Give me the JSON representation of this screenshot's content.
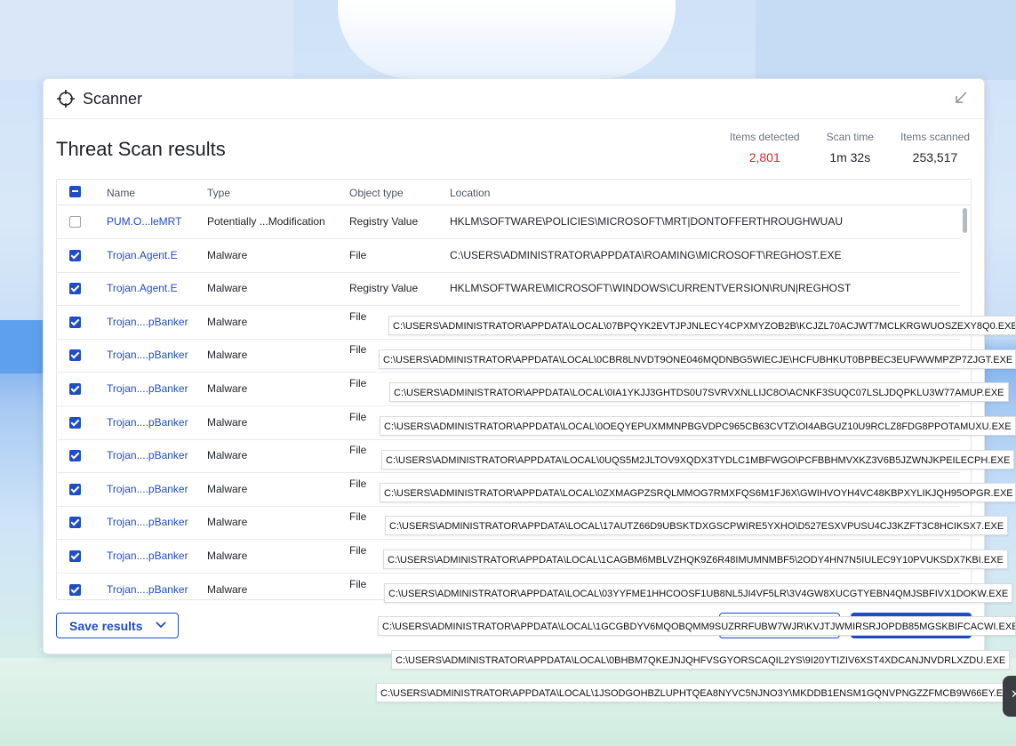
{
  "window": {
    "title": "Scanner",
    "page_title": "Threat Scan results"
  },
  "stats": [
    {
      "label": "Items detected",
      "value": "2,801",
      "color": "#d9262c"
    },
    {
      "label": "Scan time",
      "value": "1m 32s"
    },
    {
      "label": "Items scanned",
      "value": "253,517"
    }
  ],
  "table": {
    "headers": [
      "Name",
      "Type",
      "Object type",
      "Location"
    ],
    "rows": [
      {
        "checked": false,
        "name": "PUM.O...leMRT",
        "type": "Potentially ...Modification",
        "object": "Registry Value",
        "location": "HKLM\\SOFTWARE\\POLICIES\\MICROSOFT\\MRT|DONTOFFERTHROUGHWUAU"
      },
      {
        "checked": true,
        "name": "Trojan.Agent.E",
        "type": "Malware",
        "object": "File",
        "location": "C:\\USERS\\ADMINISTRATOR\\APPDATA\\ROAMING\\MICROSOFT\\REGHOST.EXE"
      },
      {
        "checked": true,
        "name": "Trojan.Agent.E",
        "type": "Malware",
        "object": "Registry Value",
        "location": "HKLM\\SOFTWARE\\MICROSOFT\\WINDOWS\\CURRENTVERSION\\RUN|REGHOST"
      },
      {
        "checked": true,
        "name": "Trojan....pBanker",
        "type": "Malware",
        "object": "File",
        "location": ""
      },
      {
        "checked": true,
        "name": "Trojan....pBanker",
        "type": "Malware",
        "object": "File",
        "location": ""
      },
      {
        "checked": true,
        "name": "Trojan....pBanker",
        "type": "Malware",
        "object": "File",
        "location": ""
      },
      {
        "checked": true,
        "name": "Trojan....pBanker",
        "type": "Malware",
        "object": "File",
        "location": ""
      },
      {
        "checked": true,
        "name": "Trojan....pBanker",
        "type": "Malware",
        "object": "File",
        "location": ""
      },
      {
        "checked": true,
        "name": "Trojan....pBanker",
        "type": "Malware",
        "object": "File",
        "location": ""
      },
      {
        "checked": true,
        "name": "Trojan....pBanker",
        "type": "Malware",
        "object": "File",
        "location": ""
      },
      {
        "checked": true,
        "name": "Trojan....pBanker",
        "type": "Malware",
        "object": "File",
        "location": ""
      },
      {
        "checked": true,
        "name": "Trojan....pBanker",
        "type": "Malware",
        "object": "File",
        "location": ""
      }
    ]
  },
  "save_button": {
    "label": "Save results"
  },
  "tooltips": [
    "C:\\USERS\\ADMINISTRATOR\\APPDATA\\LOCAL\\07BPQYK2EVTJPJNLECY4CPXMYZOB2B\\KCJZL70ACJWT7MCLKRGWUOSZEXY8Q0.EXE",
    "C:\\USERS\\ADMINISTRATOR\\APPDATA\\LOCAL\\0CBR8LNVDT9ONE046MQDNBG5WIECJE\\HCFUBHKUT0BPBEC3EUFWWMPZP7ZJGT.EXE",
    "C:\\USERS\\ADMINISTRATOR\\APPDATA\\LOCAL\\0IA1YKJJ3GHTDS0U7SVRVXNLLIJC8O\\ACNKF3SUQC07LSLJDQPKLU3W77AMUP.EXE",
    "C:\\USERS\\ADMINISTRATOR\\APPDATA\\LOCAL\\0OEQYEPUXMMNPBGVDPC965CB63CVTZ\\OI4ABGUZ10U9RCLZ8FDG8PPOTAMUXU.EXE",
    "C:\\USERS\\ADMINISTRATOR\\APPDATA\\LOCAL\\0UQS5M2JLTOV9XQDX3TYDLC1MBFWGO\\PCFBBHMVXKZ3V6B5JZWNJKPEILECPH.EXE",
    "C:\\USERS\\ADMINISTRATOR\\APPDATA\\LOCAL\\0ZXMAGPZSRQLMMOG7RMXFQS6M1FJ6X\\GWIHVOYH4VC48KBPXYLIKJQH95OPGR.EXE",
    "C:\\USERS\\ADMINISTRATOR\\APPDATA\\LOCAL\\17AUTZ66D9UBSKTDXGSCPWIRE5YXHO\\D527ESXVPUSU4CJ3KZFT3C8HCIKSX7.EXE",
    "C:\\USERS\\ADMINISTRATOR\\APPDATA\\LOCAL\\1CAGBM6MBLVZHQK9Z6R48IMUMNMBF5\\2ODY4HN7N5IULEC9Y10PVUKSDX7KBI.EXE",
    "C:\\USERS\\ADMINISTRATOR\\APPDATA\\LOCAL\\03YYFME1HHCOOSF1UB8NL5JI4VF5LR\\3V4GW8XUCGTYEBN4QMJSBFIVX1DOKW.EXE",
    "C:\\USERS\\ADMINISTRATOR\\APPDATA\\LOCAL\\1GCGBDYV6MQOBQMM9SUZRRFUBW7WJR\\KVJTJWMIRSRJOPDB85MGSKBIFCACWI.EXE",
    "C:\\USERS\\ADMINISTRATOR\\APPDATA\\LOCAL\\0BHBM7QKEJNJQHFVSGYORSCAQIL2YS\\9I20YTIZIV6XST4XDCANJNVDRLXZDU.EXE",
    "C:\\USERS\\ADMINISTRATOR\\APPDATA\\LOCAL\\1JSODGOHBZLUPHTQEA8NYVC5NJNO3Y\\MKDDB1ENSM1GQNVPNGZZFMCB9W66EY.E"
  ],
  "accent_color": "#1f4dc4"
}
